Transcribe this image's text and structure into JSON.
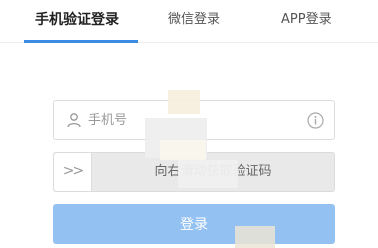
{
  "tabs": [
    {
      "label": "手机验证登录",
      "active": true
    },
    {
      "label": "微信登录",
      "active": false
    },
    {
      "label": "APP登录",
      "active": false
    }
  ],
  "phone": {
    "placeholder": "手机号",
    "value": "",
    "icon": "user-icon",
    "help_icon": "info-icon"
  },
  "slider": {
    "handle_glyph": ">>",
    "text": "向右滑动获取验证码"
  },
  "login_button": {
    "label": "登录"
  },
  "colors": {
    "accent": "#3d8ce6",
    "button": "#93c1f2",
    "border": "#dcdcdc",
    "slider_bg": "#e9e9e9"
  }
}
